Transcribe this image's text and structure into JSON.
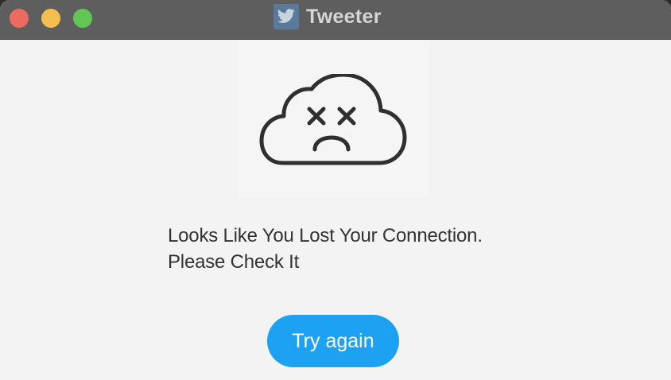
{
  "window": {
    "title": "Tweeter",
    "icon": "twitter-bird-icon"
  },
  "traffic_lights": {
    "close_color": "#ed6a5e",
    "minimize_color": "#f5bf4f",
    "maximize_color": "#62c554"
  },
  "error": {
    "illustration": "sad-cloud-icon",
    "line1": "Looks Like You Lost Your Connection.",
    "line2": "Please Check It"
  },
  "actions": {
    "retry_label": "Try again",
    "retry_color": "#1da1f2"
  }
}
